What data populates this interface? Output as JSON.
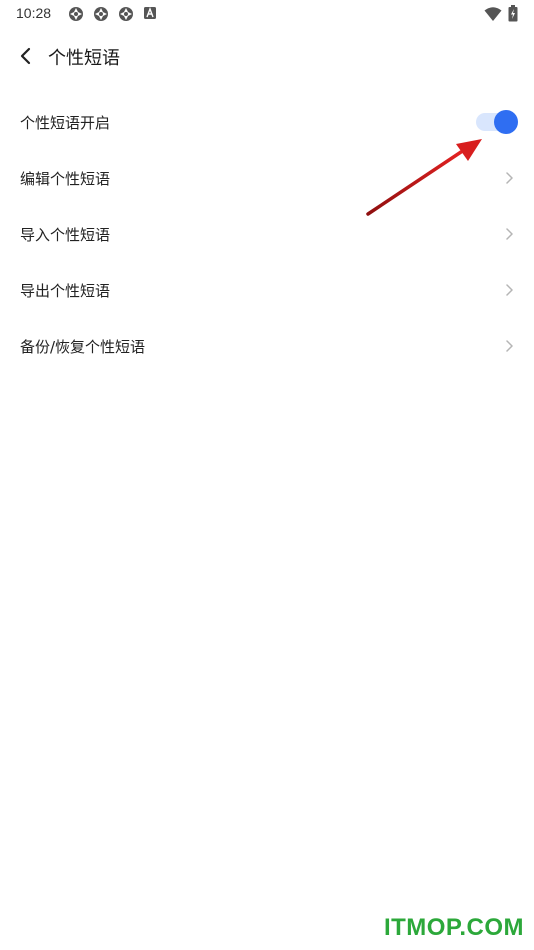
{
  "status_bar": {
    "time": "10:28",
    "left_icons": [
      "notification-icon",
      "notification-icon",
      "notification-icon",
      "keyboard-a-icon"
    ],
    "right_icons": [
      "wifi-icon",
      "battery-icon"
    ]
  },
  "header": {
    "back_icon": "chevron-left-icon",
    "title": "个性短语"
  },
  "settings": [
    {
      "label": "个性短语开启",
      "control": "toggle",
      "on": true
    },
    {
      "label": "编辑个性短语",
      "control": "chevron"
    },
    {
      "label": "导入个性短语",
      "control": "chevron"
    },
    {
      "label": "导出个性短语",
      "control": "chevron"
    },
    {
      "label": "备份/恢复个性短语",
      "control": "chevron"
    }
  ],
  "colors": {
    "accent": "#2f6ef2",
    "toggle_track": "#d9e6fd",
    "chevron": "#b5b5b5",
    "annotation_arrow": "#d81e1e",
    "watermark": "#2ca83a"
  },
  "watermark": "ITMOP.COM"
}
